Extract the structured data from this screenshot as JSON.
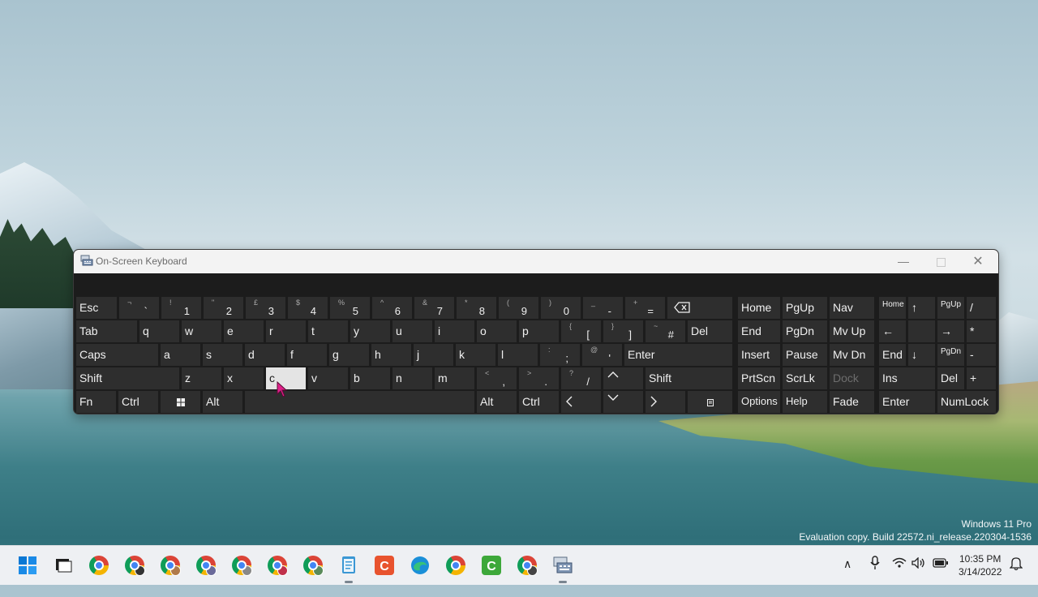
{
  "window": {
    "title": "On-Screen Keyboard"
  },
  "watermark": {
    "line1": "Windows 11 Pro",
    "line2": "Evaluation copy. Build 22572.ni_release.220304-1536"
  },
  "keyboard": {
    "row1": {
      "esc": "Esc",
      "k_grave": {
        "shift": "¬",
        "main": "`"
      },
      "k_1": {
        "shift": "!",
        "main": "1"
      },
      "k_2": {
        "shift": "\"",
        "main": "2"
      },
      "k_3": {
        "shift": "£",
        "main": "3"
      },
      "k_4": {
        "shift": "$",
        "main": "4"
      },
      "k_5": {
        "shift": "%",
        "main": "5"
      },
      "k_6": {
        "shift": "^",
        "main": "6"
      },
      "k_7": {
        "shift": "&",
        "main": "7"
      },
      "k_8": {
        "shift": "*",
        "main": "8"
      },
      "k_9": {
        "shift": "(",
        "main": "9"
      },
      "k_0": {
        "shift": ")",
        "main": "0"
      },
      "k_minus": {
        "shift": "_",
        "main": "-"
      },
      "k_equals": {
        "shift": "+",
        "main": "="
      }
    },
    "row2": {
      "tab": "Tab",
      "q": "q",
      "w": "w",
      "e": "e",
      "r": "r",
      "t": "t",
      "y": "y",
      "u": "u",
      "i": "i",
      "o": "o",
      "p": "p",
      "k_lbracket": {
        "shift": "{",
        "main": "["
      },
      "k_rbracket": {
        "shift": "}",
        "main": "]"
      },
      "k_hash": {
        "shift": "~",
        "main": "#"
      },
      "del": "Del"
    },
    "row3": {
      "caps": "Caps",
      "a": "a",
      "s": "s",
      "d": "d",
      "f": "f",
      "g": "g",
      "h": "h",
      "j": "j",
      "k": "k",
      "l": "l",
      "k_semicolon": {
        "shift": ":",
        "main": ";"
      },
      "k_apostrophe": {
        "shift": "@",
        "main": "'"
      },
      "enter": "Enter"
    },
    "row4": {
      "shift_left": "Shift",
      "z": "z",
      "x": "x",
      "c": "c",
      "v": "v",
      "b": "b",
      "n": "n",
      "m": "m",
      "k_comma": {
        "shift": "<",
        "main": ","
      },
      "k_period": {
        "shift": ">",
        "main": "."
      },
      "k_slash": {
        "shift": "?",
        "main": "/"
      },
      "shift_right": "Shift"
    },
    "row5": {
      "fn": "Fn",
      "ctrl_left": "Ctrl",
      "alt_left": "Alt",
      "alt_right": "Alt",
      "ctrl_right": "Ctrl"
    },
    "nav": {
      "home": "Home",
      "pgup": "PgUp",
      "nav": "Nav",
      "end": "End",
      "pgdn": "PgDn",
      "mvup": "Mv Up",
      "insert": "Insert",
      "pause": "Pause",
      "mvdn": "Mv Dn",
      "prtscn": "PrtScn",
      "scrlk": "ScrLk",
      "dock": "Dock",
      "options": "Options",
      "help": "Help",
      "fade": "Fade"
    },
    "numpad": {
      "home": "Home",
      "up": "↑",
      "pgup": "PgUp",
      "divide": "/",
      "left": "←",
      "right": "→",
      "multiply": "*",
      "end": "End",
      "down": "↓",
      "pgdn": "PgDn",
      "minus": "-",
      "ins": "Ins",
      "del": "Del",
      "plus": "+",
      "enter": "Enter",
      "numlock": "NumLock"
    },
    "pressed_key": "c"
  },
  "taskbar": {
    "time": "10:35 PM",
    "date": "3/14/2022"
  },
  "colors": {
    "key_bg": "#2e2e2e",
    "keyboard_bg": "#1c1c1c",
    "pressed_key_bg": "#e4e4e4",
    "cursor": "#e0218a"
  }
}
